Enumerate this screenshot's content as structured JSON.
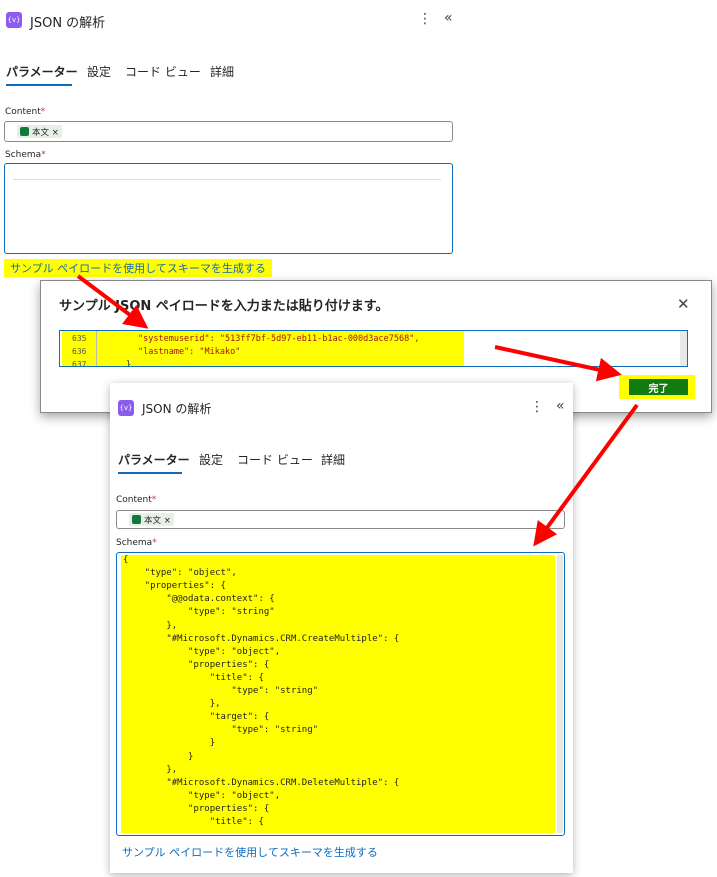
{
  "panel1": {
    "title": "JSON の解析",
    "tabs": [
      "パラメーター",
      "設定",
      "コード ビュー",
      "詳細"
    ],
    "content_label": "Content",
    "schema_label": "Schema",
    "token_label": "本文 ×",
    "generate_link": "サンプル ペイロードを使用してスキーマを生成する"
  },
  "dialog": {
    "title": "サンプル JSON ペイロードを入力または貼り付けます。",
    "lines": [
      {
        "num": "635",
        "text": "\"systemuserid\": \"513ff7bf-5d97-eb11-b1ac-000d3ace7568\","
      },
      {
        "num": "636",
        "text": "\"lastname\": \"Mikako\""
      },
      {
        "num": "637",
        "text": "}"
      }
    ],
    "done_button": "完了"
  },
  "panel2": {
    "title": "JSON の解析",
    "tabs": [
      "パラメーター",
      "設定",
      "コード ビュー",
      "詳細"
    ],
    "content_label": "Content",
    "schema_label": "Schema",
    "token_label": "本文 ×",
    "generate_link": "サンプル ペイロードを使用してスキーマを生成する",
    "schema_lines": [
      "{",
      "    \"type\": \"object\",",
      "    \"properties\": {",
      "        \"@@odata.context\": {",
      "            \"type\": \"string\"",
      "        },",
      "        \"#Microsoft.Dynamics.CRM.CreateMultiple\": {",
      "            \"type\": \"object\",",
      "            \"properties\": {",
      "                \"title\": {",
      "                    \"type\": \"string\"",
      "                },",
      "                \"target\": {",
      "                    \"type\": \"string\"",
      "                }",
      "            }",
      "        },",
      "        \"#Microsoft.Dynamics.CRM.DeleteMultiple\": {",
      "            \"type\": \"object\",",
      "            \"properties\": {",
      "                \"title\": {"
    ]
  },
  "colors": {
    "accent": "#0f6cbd",
    "highlight": "#ffff00",
    "done_button": "#107c10",
    "arrow": "#ff0000",
    "action_icon": "#8a5cf0"
  },
  "icons": {
    "action": "json-parse-icon",
    "more": "more-vertical-icon",
    "collapse": "double-chevron-left-icon",
    "close": "close-icon",
    "token": "body-token-icon"
  }
}
